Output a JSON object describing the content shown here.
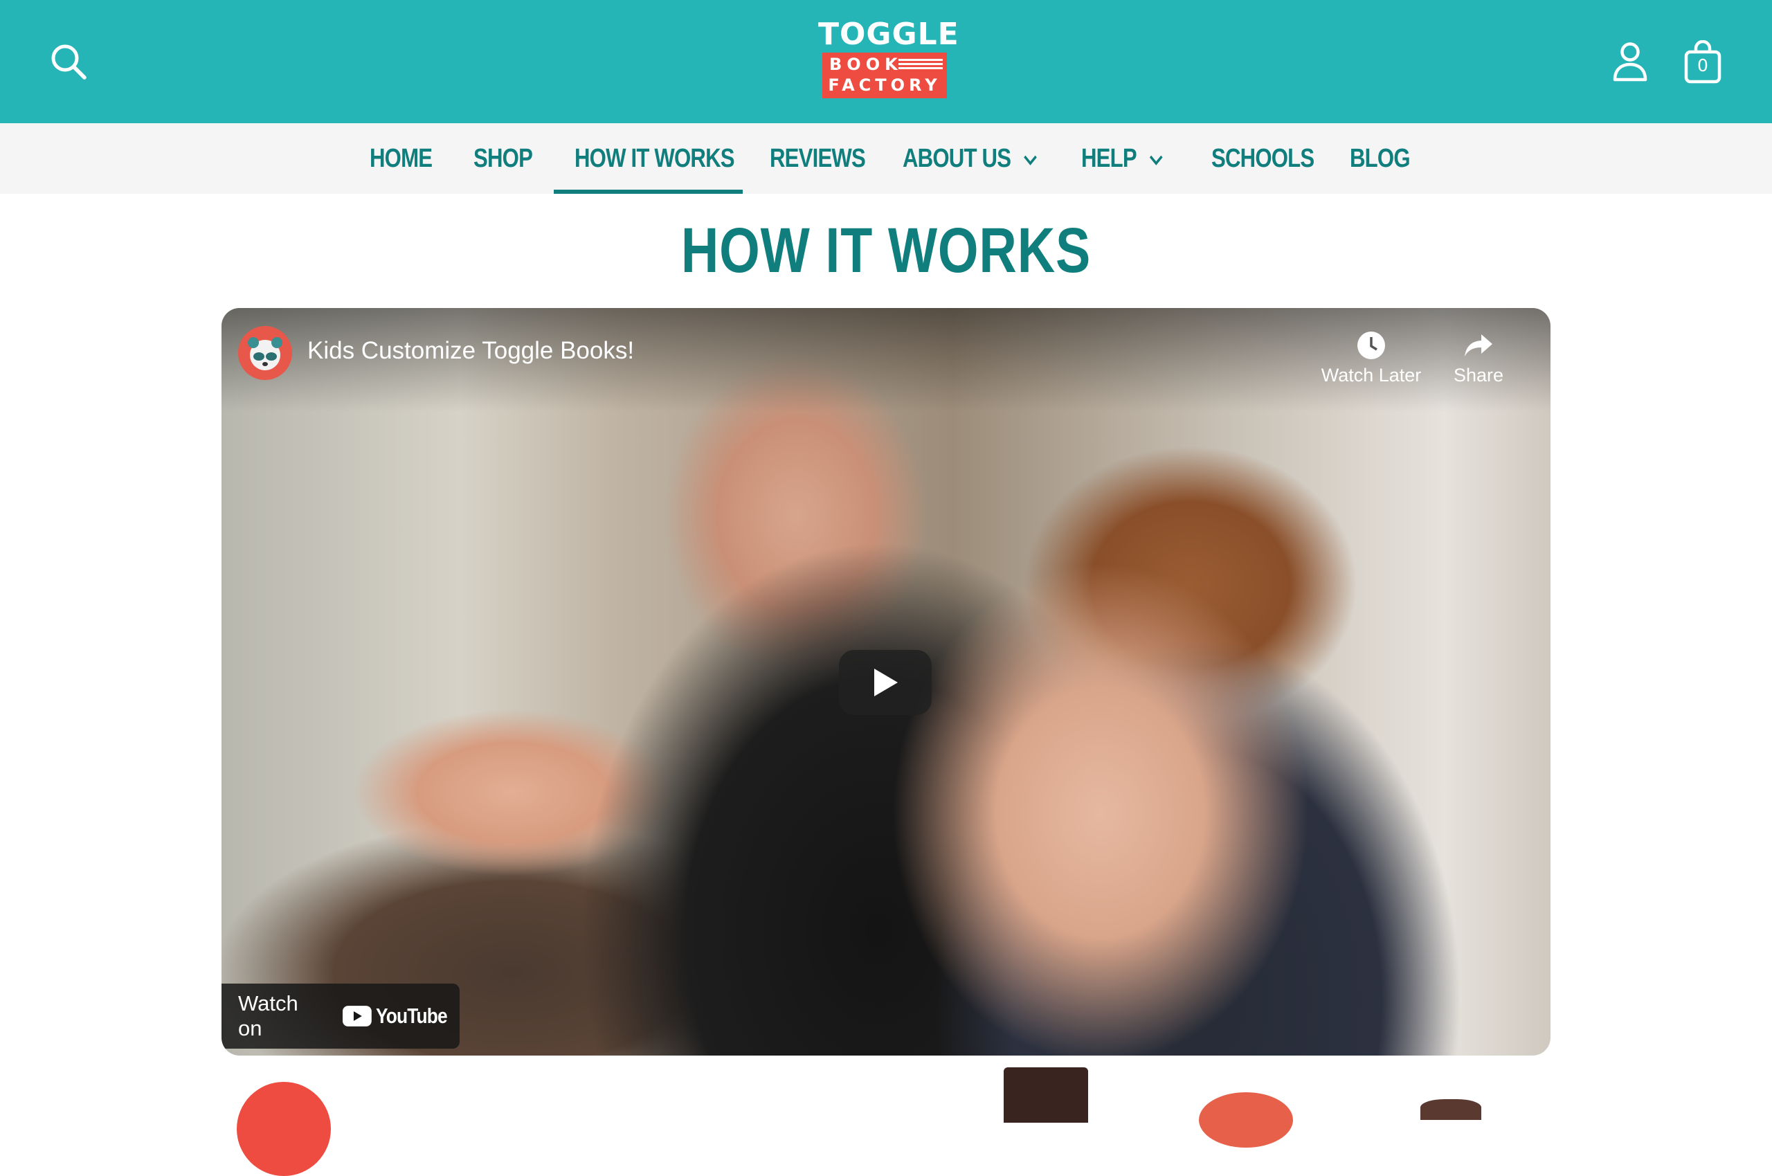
{
  "header": {
    "logo": {
      "line1": "TOGGLE",
      "line2": "BOOK",
      "line3": "FACTORY"
    },
    "cart_count": "0",
    "icons": {
      "search": "search-icon",
      "account": "account-icon",
      "cart": "cart-bag-icon"
    }
  },
  "nav": {
    "items": [
      {
        "label": "HOME"
      },
      {
        "label": "SHOP"
      },
      {
        "label": "HOW IT WORKS"
      },
      {
        "label": "REVIEWS"
      },
      {
        "label": "ABOUT US"
      },
      {
        "label": "HELP"
      },
      {
        "label": "SCHOOLS"
      },
      {
        "label": "BLOG"
      }
    ],
    "active": "HOW IT WORKS"
  },
  "page": {
    "title": "HOW IT WORKS"
  },
  "video": {
    "title": "Kids Customize Toggle Books!",
    "watch_later": "Watch Later",
    "share": "Share",
    "watch_on": "Watch on",
    "platform": "YouTube"
  },
  "colors": {
    "header_bg": "#25b5b7",
    "nav_bg": "#f5f5f5",
    "accent": "#117e7e",
    "logo_red": "#ee4c40"
  }
}
